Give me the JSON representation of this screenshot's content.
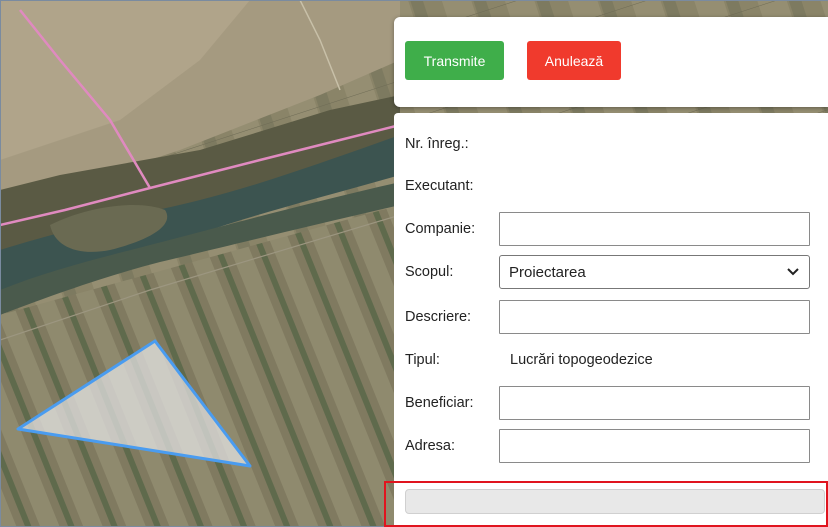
{
  "toolbar": {
    "submit_label": "Transmite",
    "cancel_label": "Anulează"
  },
  "form": {
    "reg_no": {
      "label": "Nr. înreg.:"
    },
    "executant": {
      "label": "Executant:"
    },
    "company": {
      "label": "Companie:",
      "value": ""
    },
    "purpose": {
      "label": "Scopul:",
      "selected": "Proiectarea"
    },
    "description": {
      "label": "Descriere:",
      "value": ""
    },
    "type": {
      "label": "Tipul:",
      "value": "Lucrări topogeodezice"
    },
    "beneficiary": {
      "label": "Beneficiar:",
      "value": ""
    },
    "address": {
      "label": "Adresa:",
      "value": ""
    }
  },
  "colors": {
    "submit": "#3fae4a",
    "cancel": "#f03a2d",
    "polygon_stroke": "#4a9cf0",
    "boundary_line": "#e08ac0",
    "highlight": "#e0141e"
  },
  "icons": {
    "dropdown": "chevron-down-icon"
  }
}
